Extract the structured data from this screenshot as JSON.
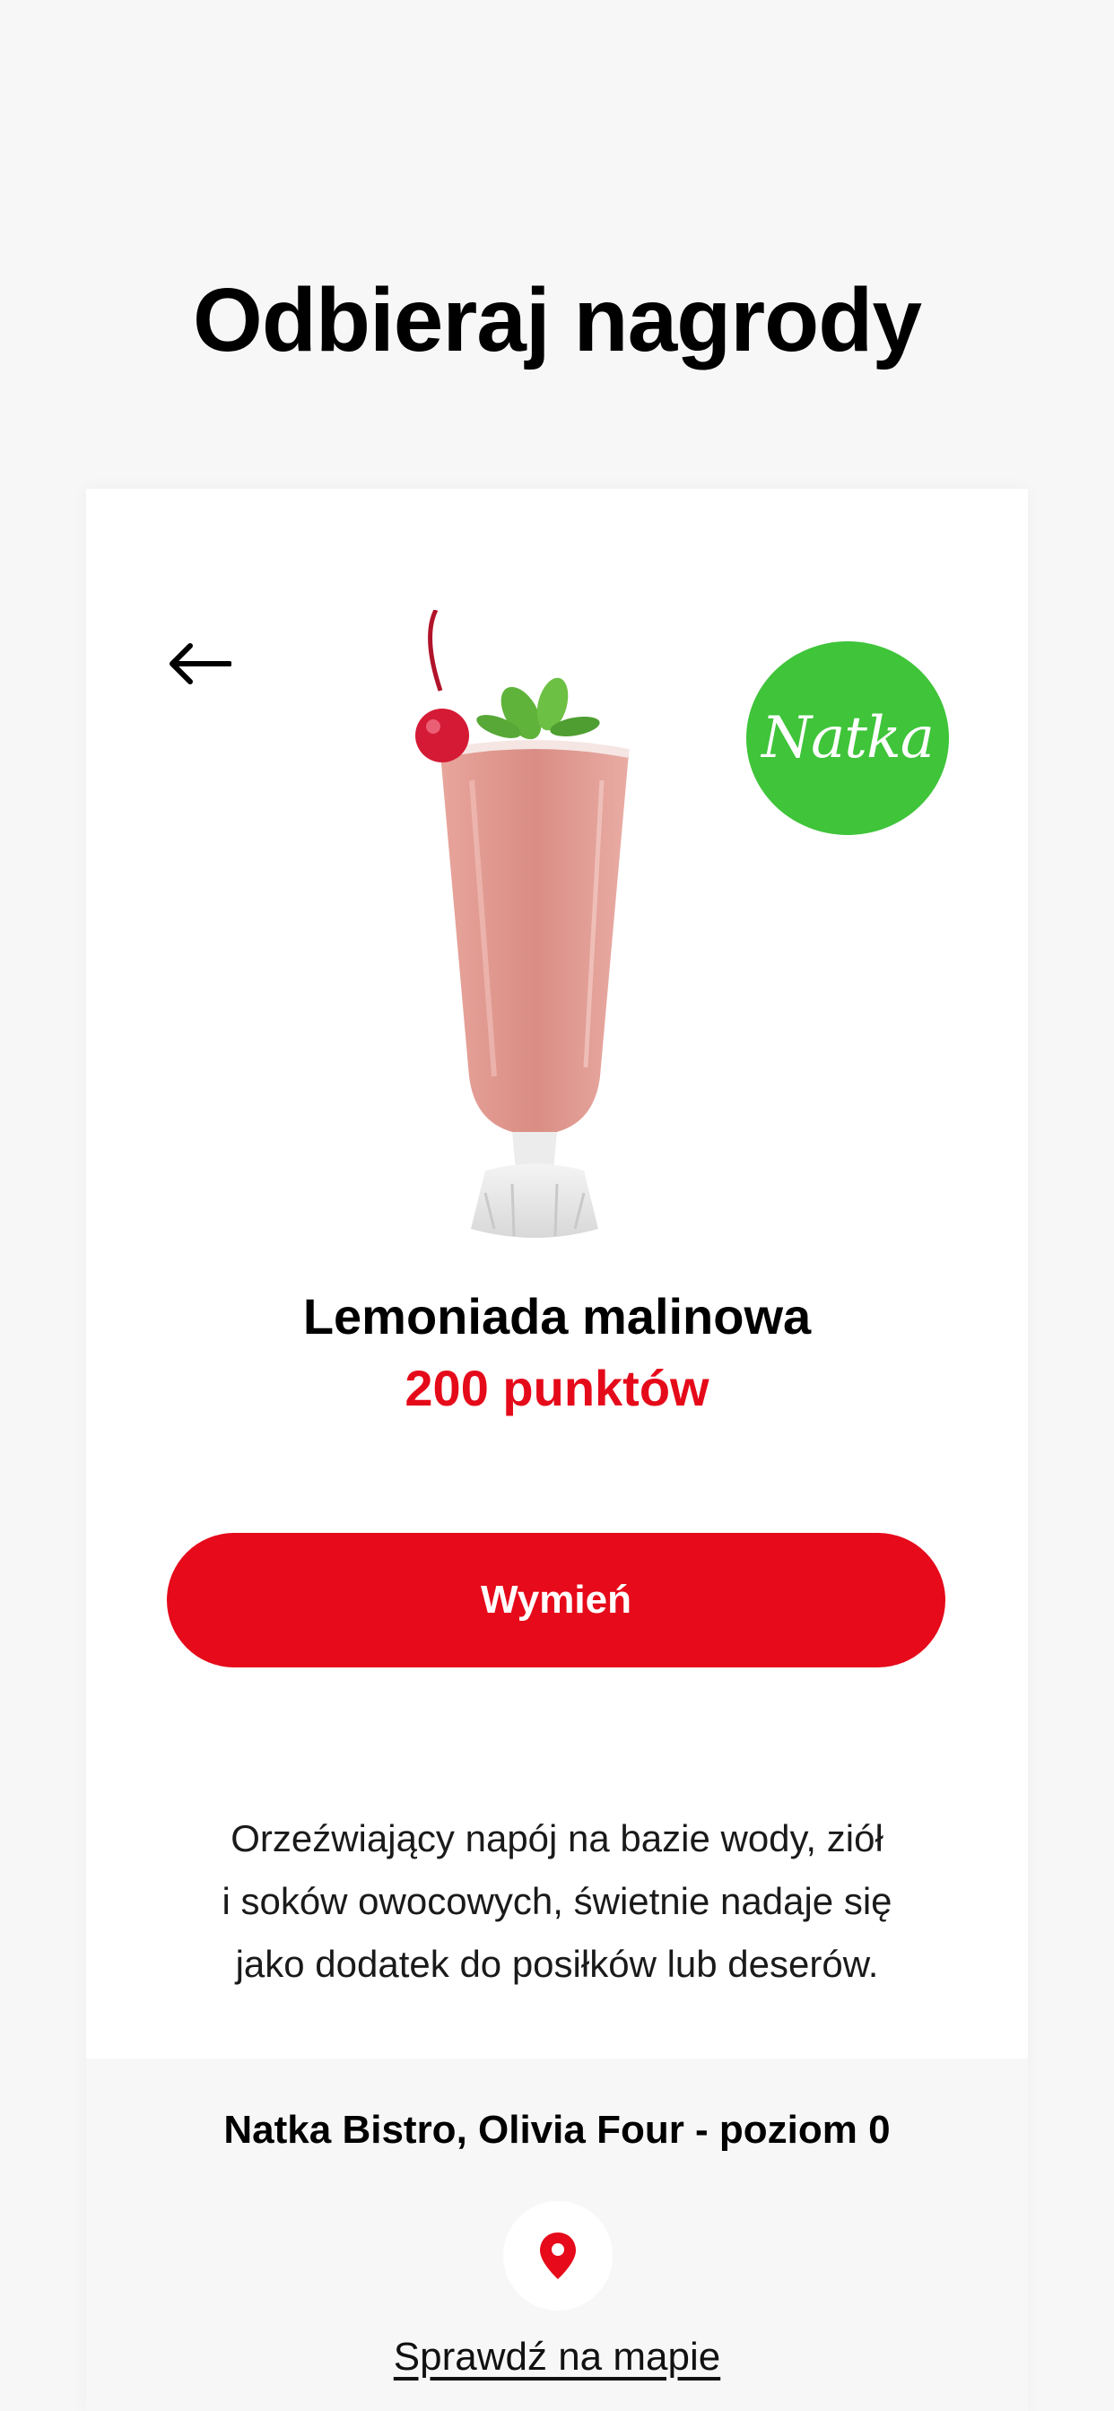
{
  "header": {
    "title": "Odbieraj nagrody"
  },
  "reward": {
    "brand_logo_text": "Natka",
    "brand_color": "#3fc43a",
    "name": "Lemoniada malinowa",
    "points": "200 punktów",
    "points_color": "#e50a1a",
    "redeem_label": "Wymień",
    "description_lines": [
      "Orzeźwiający napój na bazie wody, ziół",
      "i soków owocowych, świetnie nadaje się",
      "jako dodatek do posiłków lub deserów."
    ]
  },
  "location": {
    "name": "Natka Bistro, Olivia Four - poziom 0",
    "map_link_label": "Sprawdź na mapie",
    "pin_icon": "map-pin-icon"
  },
  "icons": {
    "back": "arrow-left-icon"
  }
}
